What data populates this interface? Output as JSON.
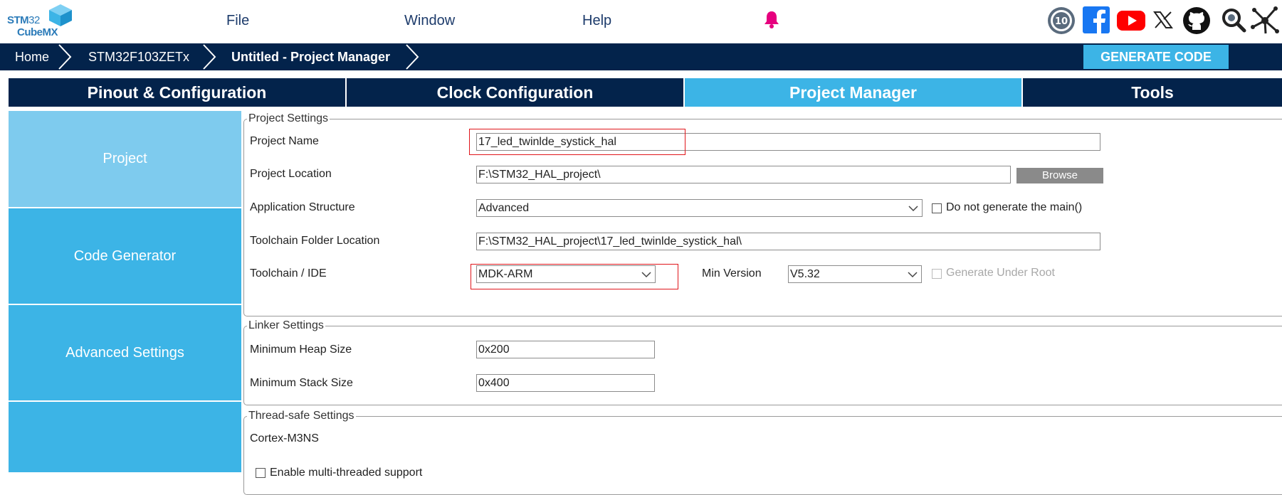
{
  "app": {
    "logo_line1a": "STM",
    "logo_line1b": "32",
    "logo_line2": "CubeMX"
  },
  "menu": {
    "file": "File",
    "window": "Window",
    "help": "Help"
  },
  "social_icons": [
    "anniversary-10-icon",
    "facebook-icon",
    "youtube-icon",
    "x-icon",
    "github-icon",
    "search-community-icon",
    "network-icon"
  ],
  "breadcrumb": {
    "home": "Home",
    "device": "STM32F103ZETx",
    "current": "Untitled - Project Manager"
  },
  "generate_button": "GENERATE CODE",
  "tabs": [
    {
      "label": "Pinout & Configuration",
      "active": false
    },
    {
      "label": "Clock Configuration",
      "active": false
    },
    {
      "label": "Project Manager",
      "active": true
    },
    {
      "label": "Tools",
      "active": false
    }
  ],
  "sidebar": [
    {
      "label": "Project",
      "active": true
    },
    {
      "label": "Code Generator",
      "active": false
    },
    {
      "label": "Advanced Settings",
      "active": false
    },
    {
      "label": "",
      "active": false
    }
  ],
  "project_settings": {
    "legend": "Project Settings",
    "project_name_label": "Project Name",
    "project_name_value": "17_led_twinlde_systick_hal",
    "project_location_label": "Project Location",
    "project_location_value": "F:\\STM32_HAL_project\\",
    "browse_label": "Browse",
    "app_structure_label": "Application Structure",
    "app_structure_value": "Advanced",
    "no_main_label": "Do not generate the main()",
    "toolchain_folder_label": "Toolchain Folder Location",
    "toolchain_folder_value": "F:\\STM32_HAL_project\\17_led_twinlde_systick_hal\\",
    "toolchain_ide_label": "Toolchain / IDE",
    "toolchain_ide_value": "MDK-ARM",
    "min_version_label": "Min Version",
    "min_version_value": "V5.32",
    "generate_under_root_label": "Generate Under Root"
  },
  "linker_settings": {
    "legend": "Linker Settings",
    "heap_label": "Minimum Heap Size",
    "heap_value": "0x200",
    "stack_label": "Minimum Stack Size",
    "stack_value": "0x400"
  },
  "thread_settings": {
    "legend": "Thread-safe Settings",
    "core_label": "Cortex-M3NS",
    "multi_thread_label": "Enable multi-threaded support"
  },
  "colors": {
    "navy": "#03234b",
    "accent": "#3cb4e6",
    "highlight_red": "#e0161b"
  }
}
